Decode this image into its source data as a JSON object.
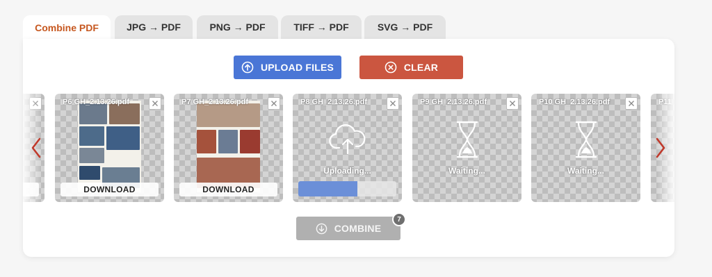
{
  "tabs": [
    {
      "label": "Combine PDF",
      "active": true
    },
    {
      "label": "JPG → PDF",
      "active": false
    },
    {
      "label": "PNG → PDF",
      "active": false
    },
    {
      "label": "TIFF → PDF",
      "active": false
    },
    {
      "label": "SVG → PDF",
      "active": false
    }
  ],
  "toolbar": {
    "upload_label": "UPLOAD FILES",
    "clear_label": "CLEAR"
  },
  "files": [
    {
      "name": "P6 GH_2.13.26.pdf",
      "state": "done",
      "action_label": "DOWNLOAD"
    },
    {
      "name": "P7 GH_2.13.26.pdf",
      "state": "done",
      "action_label": "DOWNLOAD"
    },
    {
      "name": "P8 GH_2.13.26.pdf",
      "state": "uploading",
      "status_label": "Uploading...",
      "progress": 0.6
    },
    {
      "name": "P9 GH_2.13.26.pdf",
      "state": "waiting",
      "status_label": "Waiting..."
    },
    {
      "name": "P10 GH_2.13.26.pdf",
      "state": "waiting",
      "status_label": "Waiting..."
    },
    {
      "name": "P11",
      "state": "partial"
    }
  ],
  "combine": {
    "label": "COMBINE",
    "count": "7"
  },
  "colors": {
    "accent_tab": "#c6571f",
    "upload": "#4a76d6",
    "clear": "#cb5640",
    "combine_disabled": "#b0b0b0",
    "nav_arrow": "#c0392b"
  },
  "icons": [
    "upload-circle-icon",
    "clear-circle-x-icon",
    "download-circle-icon",
    "close-icon",
    "cloud-upload-icon",
    "hourglass-icon",
    "chevron-left-icon",
    "chevron-right-icon"
  ]
}
